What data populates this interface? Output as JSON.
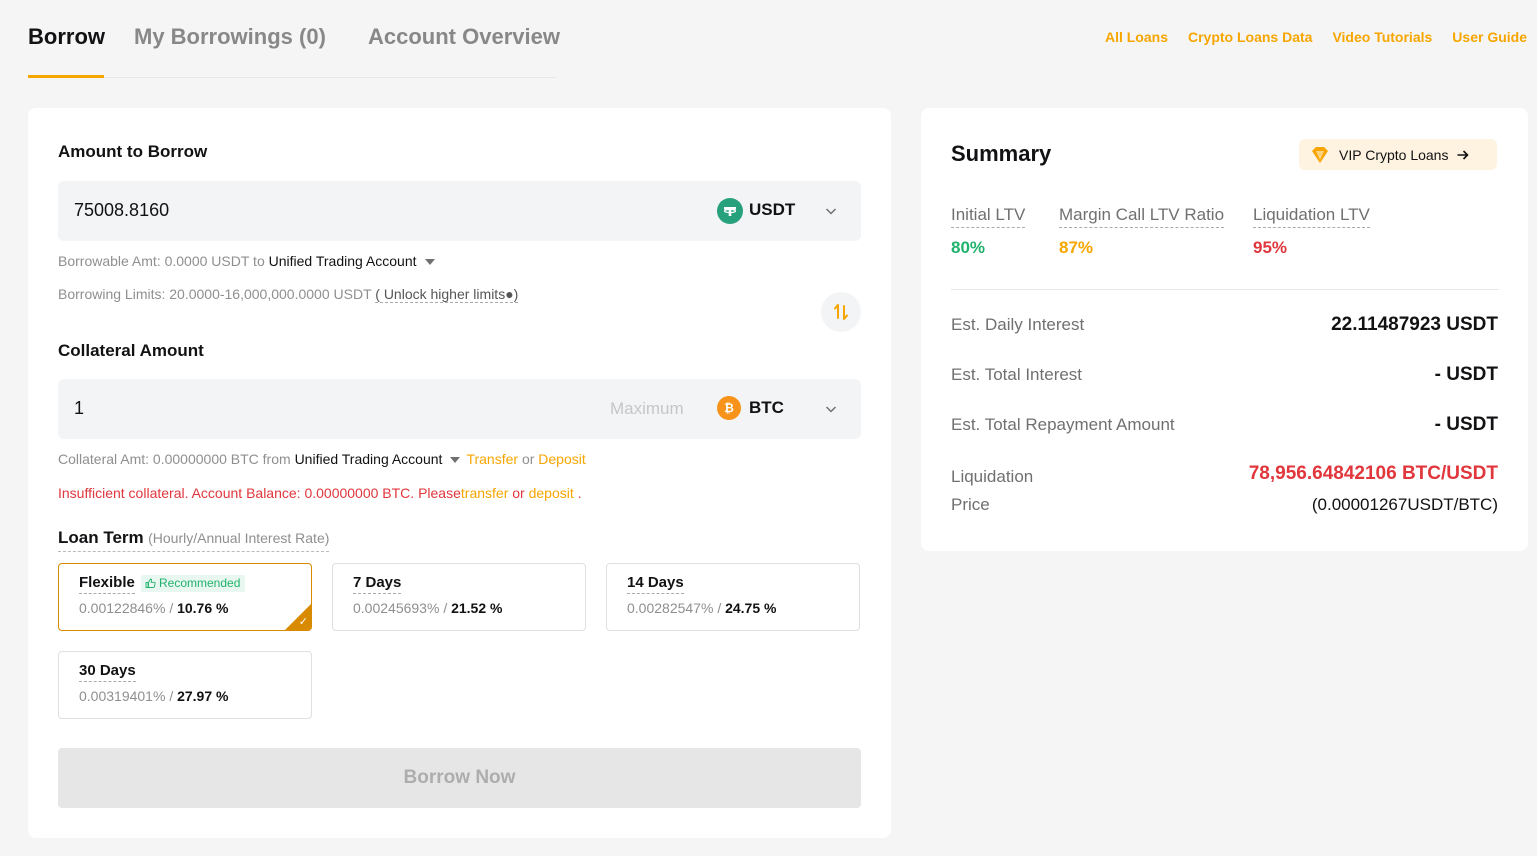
{
  "tabs": {
    "borrow": "Borrow",
    "my_borrowings": "My Borrowings (0)",
    "account_overview": "Account Overview"
  },
  "toplinks": {
    "all_loans": "All Loans",
    "crypto_loans_data": "Crypto Loans Data",
    "video_tutorials": "Video Tutorials",
    "user_guide": "User Guide"
  },
  "borrow": {
    "amount_label": "Amount to Borrow",
    "amount_value": "75008.8160",
    "borrow_coin": "USDT",
    "borrowable_prefix": "Borrowable Amt: 0.0000 USDT to",
    "borrowable_account": "Unified Trading Account",
    "limits_text": "Borrowing Limits: 20.0000-16,000,000.0000 USDT",
    "unlock_text": "( Unlock higher limits●)"
  },
  "collateral": {
    "label": "Collateral Amount",
    "value": "1",
    "max_label": "Maximum",
    "coin": "BTC",
    "amt_prefix": "Collateral Amt: 0.00000000 BTC from",
    "account": "Unified Trading Account",
    "transfer": "Transfer",
    "or": "or",
    "deposit": "Deposit",
    "error_prefix": "Insufficient collateral. Account Balance: 0.00000000 BTC. Please",
    "error_transfer": "transfer",
    "error_or": "or",
    "error_deposit": "deposit",
    "error_suffix": "."
  },
  "loan_term": {
    "title": "Loan Term",
    "hint": "(Hourly/Annual Interest Rate)",
    "recommended": "Recommended",
    "options": [
      {
        "name": "Flexible",
        "hourly": "0.00122846%",
        "annual": "10.76 %"
      },
      {
        "name": "7 Days",
        "hourly": "0.00245693%",
        "annual": "21.52 %"
      },
      {
        "name": "14 Days",
        "hourly": "0.00282547%",
        "annual": "24.75 %"
      },
      {
        "name": "30 Days",
        "hourly": "0.00319401%",
        "annual": "27.97 %"
      }
    ],
    "separator": "/"
  },
  "borrow_now": "Borrow Now",
  "summary": {
    "title": "Summary",
    "vip_label": "VIP Crypto Loans",
    "initial_ltv_label": "Initial LTV",
    "initial_ltv": "80%",
    "margin_call_label": "Margin Call LTV Ratio",
    "margin_call": "87%",
    "liquidation_ltv_label": "Liquidation LTV",
    "liquidation_ltv": "95%",
    "daily_interest_label": "Est. Daily Interest",
    "daily_interest": "22.11487923 USDT",
    "total_interest_label": "Est. Total Interest",
    "total_interest": "- USDT",
    "total_repayment_label": "Est. Total Repayment Amount",
    "total_repayment": "- USDT",
    "liq_price_label_1": "Liquidation",
    "liq_price_label_2": "Price",
    "liq_price": "78,956.64842106 BTC/USDT",
    "liq_price_sub": "(0.00001267USDT/BTC)"
  },
  "colors": {
    "accent": "#f7a600",
    "green": "#20b26c",
    "red": "#e0363c",
    "selected_border": "#d88a00"
  }
}
